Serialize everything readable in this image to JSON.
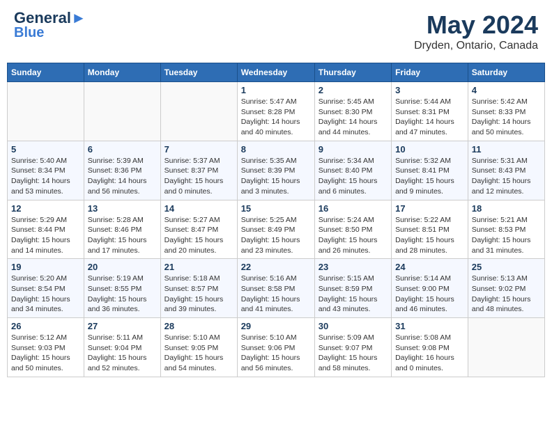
{
  "logo": {
    "line1": "General",
    "line2": "Blue"
  },
  "title": "May 2024",
  "subtitle": "Dryden, Ontario, Canada",
  "weekdays": [
    "Sunday",
    "Monday",
    "Tuesday",
    "Wednesday",
    "Thursday",
    "Friday",
    "Saturday"
  ],
  "weeks": [
    [
      {
        "day": "",
        "info": ""
      },
      {
        "day": "",
        "info": ""
      },
      {
        "day": "",
        "info": ""
      },
      {
        "day": "1",
        "info": "Sunrise: 5:47 AM\nSunset: 8:28 PM\nDaylight: 14 hours\nand 40 minutes."
      },
      {
        "day": "2",
        "info": "Sunrise: 5:45 AM\nSunset: 8:30 PM\nDaylight: 14 hours\nand 44 minutes."
      },
      {
        "day": "3",
        "info": "Sunrise: 5:44 AM\nSunset: 8:31 PM\nDaylight: 14 hours\nand 47 minutes."
      },
      {
        "day": "4",
        "info": "Sunrise: 5:42 AM\nSunset: 8:33 PM\nDaylight: 14 hours\nand 50 minutes."
      }
    ],
    [
      {
        "day": "5",
        "info": "Sunrise: 5:40 AM\nSunset: 8:34 PM\nDaylight: 14 hours\nand 53 minutes."
      },
      {
        "day": "6",
        "info": "Sunrise: 5:39 AM\nSunset: 8:36 PM\nDaylight: 14 hours\nand 56 minutes."
      },
      {
        "day": "7",
        "info": "Sunrise: 5:37 AM\nSunset: 8:37 PM\nDaylight: 15 hours\nand 0 minutes."
      },
      {
        "day": "8",
        "info": "Sunrise: 5:35 AM\nSunset: 8:39 PM\nDaylight: 15 hours\nand 3 minutes."
      },
      {
        "day": "9",
        "info": "Sunrise: 5:34 AM\nSunset: 8:40 PM\nDaylight: 15 hours\nand 6 minutes."
      },
      {
        "day": "10",
        "info": "Sunrise: 5:32 AM\nSunset: 8:41 PM\nDaylight: 15 hours\nand 9 minutes."
      },
      {
        "day": "11",
        "info": "Sunrise: 5:31 AM\nSunset: 8:43 PM\nDaylight: 15 hours\nand 12 minutes."
      }
    ],
    [
      {
        "day": "12",
        "info": "Sunrise: 5:29 AM\nSunset: 8:44 PM\nDaylight: 15 hours\nand 14 minutes."
      },
      {
        "day": "13",
        "info": "Sunrise: 5:28 AM\nSunset: 8:46 PM\nDaylight: 15 hours\nand 17 minutes."
      },
      {
        "day": "14",
        "info": "Sunrise: 5:27 AM\nSunset: 8:47 PM\nDaylight: 15 hours\nand 20 minutes."
      },
      {
        "day": "15",
        "info": "Sunrise: 5:25 AM\nSunset: 8:49 PM\nDaylight: 15 hours\nand 23 minutes."
      },
      {
        "day": "16",
        "info": "Sunrise: 5:24 AM\nSunset: 8:50 PM\nDaylight: 15 hours\nand 26 minutes."
      },
      {
        "day": "17",
        "info": "Sunrise: 5:22 AM\nSunset: 8:51 PM\nDaylight: 15 hours\nand 28 minutes."
      },
      {
        "day": "18",
        "info": "Sunrise: 5:21 AM\nSunset: 8:53 PM\nDaylight: 15 hours\nand 31 minutes."
      }
    ],
    [
      {
        "day": "19",
        "info": "Sunrise: 5:20 AM\nSunset: 8:54 PM\nDaylight: 15 hours\nand 34 minutes."
      },
      {
        "day": "20",
        "info": "Sunrise: 5:19 AM\nSunset: 8:55 PM\nDaylight: 15 hours\nand 36 minutes."
      },
      {
        "day": "21",
        "info": "Sunrise: 5:18 AM\nSunset: 8:57 PM\nDaylight: 15 hours\nand 39 minutes."
      },
      {
        "day": "22",
        "info": "Sunrise: 5:16 AM\nSunset: 8:58 PM\nDaylight: 15 hours\nand 41 minutes."
      },
      {
        "day": "23",
        "info": "Sunrise: 5:15 AM\nSunset: 8:59 PM\nDaylight: 15 hours\nand 43 minutes."
      },
      {
        "day": "24",
        "info": "Sunrise: 5:14 AM\nSunset: 9:00 PM\nDaylight: 15 hours\nand 46 minutes."
      },
      {
        "day": "25",
        "info": "Sunrise: 5:13 AM\nSunset: 9:02 PM\nDaylight: 15 hours\nand 48 minutes."
      }
    ],
    [
      {
        "day": "26",
        "info": "Sunrise: 5:12 AM\nSunset: 9:03 PM\nDaylight: 15 hours\nand 50 minutes."
      },
      {
        "day": "27",
        "info": "Sunrise: 5:11 AM\nSunset: 9:04 PM\nDaylight: 15 hours\nand 52 minutes."
      },
      {
        "day": "28",
        "info": "Sunrise: 5:10 AM\nSunset: 9:05 PM\nDaylight: 15 hours\nand 54 minutes."
      },
      {
        "day": "29",
        "info": "Sunrise: 5:10 AM\nSunset: 9:06 PM\nDaylight: 15 hours\nand 56 minutes."
      },
      {
        "day": "30",
        "info": "Sunrise: 5:09 AM\nSunset: 9:07 PM\nDaylight: 15 hours\nand 58 minutes."
      },
      {
        "day": "31",
        "info": "Sunrise: 5:08 AM\nSunset: 9:08 PM\nDaylight: 16 hours\nand 0 minutes."
      },
      {
        "day": "",
        "info": ""
      }
    ]
  ]
}
